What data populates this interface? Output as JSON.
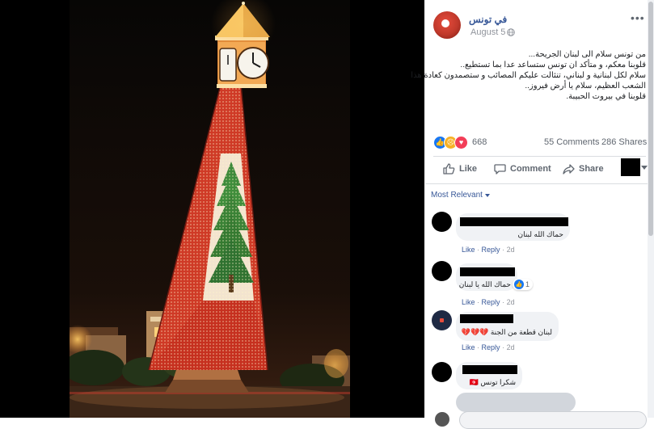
{
  "page": {
    "name": "في تونس",
    "date": "August 5",
    "options_icon": "ellipsis-icon"
  },
  "post": {
    "lines": [
      "من تونس سلام الى لبنان الجريحة...",
      "قلوبنا معكم، و متأكد ان تونس ستساعد عدا بما تستطيع..",
      "سلام لكل لبنانية و لبناني، تنثالت عليكم المصائب و ستصمدون كعادة هذا",
      "الشعب العظيم، سلام يا أرض فيروز..",
      "قلوبنا في بيروت الحبيبة."
    ]
  },
  "stats": {
    "reaction_count": "668",
    "comments": "55 Comments",
    "shares": "286 Shares",
    "reaction_colors": {
      "like": "#1877f2",
      "sad": "#f7b125",
      "love": "#f33e58"
    }
  },
  "actions": {
    "like": "Like",
    "comment": "Comment",
    "share": "Share"
  },
  "sort": {
    "label": "Most Relevant"
  },
  "comments": [
    {
      "text": "حماك الله لبنان",
      "like": "Like",
      "reply": "Reply",
      "time": "2d"
    },
    {
      "text": "حماك الله يا لبنان",
      "like": "Like",
      "reply": "Reply",
      "time": "2d",
      "reactions": "1"
    },
    {
      "text": "لبنان قطعة من الجنة 💔💔💔",
      "like": "Like",
      "reply": "Reply",
      "time": "2d"
    },
    {
      "text": "شكرا تونس 🇹🇳",
      "like": "Like",
      "reply": "Reply",
      "time": "2d"
    }
  ],
  "colors": {
    "link": "#385898",
    "muted": "#90949c",
    "bubble": "#f0f2f5",
    "tower_red": "#c8281e",
    "tower_white": "#f1e3d3",
    "cedar_green": "#3e8a3a"
  }
}
